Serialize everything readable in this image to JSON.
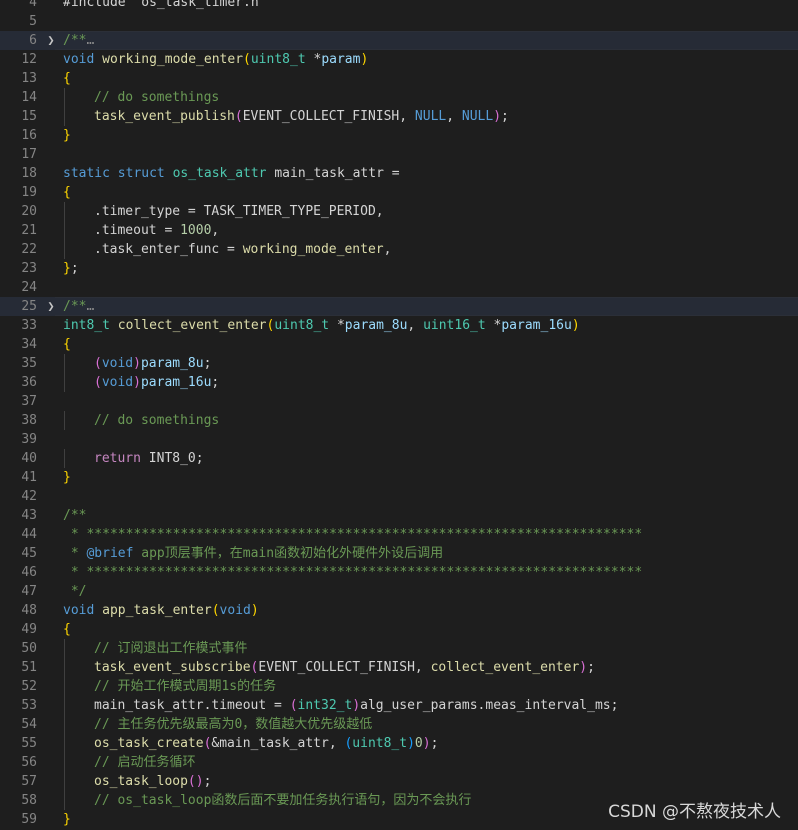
{
  "theme": {
    "background": "#1e1e1e",
    "line_number": "#858585",
    "colors": {
      "keyword": "#569cd6",
      "control": "#c586c0",
      "type": "#4ec9b0",
      "function": "#dcdcaa",
      "variable": "#9cdcfe",
      "param": "#9cdcfe",
      "number": "#b5cea8",
      "comment": "#6a9955",
      "doctag": "#569cd6",
      "constant": "#4fc1ff",
      "brace1": "#ffd700",
      "brace2": "#da70d6",
      "brace3": "#179fff",
      "plain": "#d4d4d4"
    }
  },
  "lines": [
    {
      "n": "4",
      "tokens": [
        [
          "#include \"os_task_timer.h\"",
          "plain"
        ]
      ]
    },
    {
      "n": "5",
      "tokens": []
    },
    {
      "n": "6",
      "fold": true,
      "hl": true,
      "tokens": [
        [
          "/**",
          "comment"
        ],
        [
          "…",
          "ellipsis"
        ]
      ]
    },
    {
      "n": "12",
      "tokens": [
        [
          "void",
          "keyword"
        ],
        [
          " ",
          "plain"
        ],
        [
          "working_mode_enter",
          "function"
        ],
        [
          "(",
          "brace1"
        ],
        [
          "uint8_t",
          "type"
        ],
        [
          " *",
          "plain"
        ],
        [
          "param",
          "param"
        ],
        [
          ")",
          "brace1"
        ]
      ]
    },
    {
      "n": "13",
      "tokens": [
        [
          "{",
          "brace1"
        ]
      ]
    },
    {
      "n": "14",
      "indent": 1,
      "tokens": [
        [
          "// do somethings",
          "comment"
        ]
      ]
    },
    {
      "n": "15",
      "indent": 1,
      "tokens": [
        [
          "task_event_publish",
          "function"
        ],
        [
          "(",
          "brace2"
        ],
        [
          "EVENT_COLLECT_FINISH",
          "plain"
        ],
        [
          ", ",
          "plain"
        ],
        [
          "NULL",
          "keyword"
        ],
        [
          ", ",
          "plain"
        ],
        [
          "NULL",
          "keyword"
        ],
        [
          ")",
          "brace2"
        ],
        [
          ";",
          "plain"
        ]
      ]
    },
    {
      "n": "16",
      "tokens": [
        [
          "}",
          "brace1"
        ]
      ]
    },
    {
      "n": "17",
      "tokens": []
    },
    {
      "n": "18",
      "tokens": [
        [
          "static",
          "keyword"
        ],
        [
          " ",
          "plain"
        ],
        [
          "struct",
          "keyword"
        ],
        [
          " ",
          "plain"
        ],
        [
          "os_task_attr",
          "type"
        ],
        [
          " main_task_attr =",
          "plain"
        ]
      ]
    },
    {
      "n": "19",
      "tokens": [
        [
          "{",
          "brace1"
        ]
      ]
    },
    {
      "n": "20",
      "indent": 1,
      "tokens": [
        [
          ".timer_type",
          "plain"
        ],
        [
          " = ",
          "plain"
        ],
        [
          "TASK_TIMER_TYPE_PERIOD",
          "plain"
        ],
        [
          ",",
          "plain"
        ]
      ]
    },
    {
      "n": "21",
      "indent": 1,
      "tokens": [
        [
          ".timeout",
          "plain"
        ],
        [
          " = ",
          "plain"
        ],
        [
          "1000",
          "number"
        ],
        [
          ",",
          "plain"
        ]
      ]
    },
    {
      "n": "22",
      "indent": 1,
      "tokens": [
        [
          ".task_enter_func",
          "plain"
        ],
        [
          " = ",
          "plain"
        ],
        [
          "working_mode_enter",
          "function"
        ],
        [
          ",",
          "plain"
        ]
      ]
    },
    {
      "n": "23",
      "tokens": [
        [
          "}",
          "brace1"
        ],
        [
          ";",
          "plain"
        ]
      ]
    },
    {
      "n": "24",
      "tokens": []
    },
    {
      "n": "25",
      "fold": true,
      "hl": true,
      "tokens": [
        [
          "/**",
          "comment"
        ],
        [
          "…",
          "ellipsis"
        ]
      ]
    },
    {
      "n": "33",
      "tokens": [
        [
          "int8_t",
          "type"
        ],
        [
          " ",
          "plain"
        ],
        [
          "collect_event_enter",
          "function"
        ],
        [
          "(",
          "brace1"
        ],
        [
          "uint8_t",
          "type"
        ],
        [
          " *",
          "plain"
        ],
        [
          "param_8u",
          "param"
        ],
        [
          ", ",
          "plain"
        ],
        [
          "uint16_t",
          "type"
        ],
        [
          " *",
          "plain"
        ],
        [
          "param_16u",
          "param"
        ],
        [
          ")",
          "brace1"
        ]
      ]
    },
    {
      "n": "34",
      "tokens": [
        [
          "{",
          "brace1"
        ]
      ]
    },
    {
      "n": "35",
      "indent": 1,
      "tokens": [
        [
          "(",
          "brace2"
        ],
        [
          "void",
          "keyword"
        ],
        [
          ")",
          "brace2"
        ],
        [
          "param_8u",
          "param"
        ],
        [
          ";",
          "plain"
        ]
      ]
    },
    {
      "n": "36",
      "indent": 1,
      "tokens": [
        [
          "(",
          "brace2"
        ],
        [
          "void",
          "keyword"
        ],
        [
          ")",
          "brace2"
        ],
        [
          "param_16u",
          "param"
        ],
        [
          ";",
          "plain"
        ]
      ]
    },
    {
      "n": "37",
      "tokens": []
    },
    {
      "n": "38",
      "indent": 1,
      "tokens": [
        [
          "// do somethings",
          "comment"
        ]
      ]
    },
    {
      "n": "39",
      "tokens": []
    },
    {
      "n": "40",
      "indent": 1,
      "tokens": [
        [
          "return",
          "control"
        ],
        [
          " ",
          "plain"
        ],
        [
          "INT8_0",
          "plain"
        ],
        [
          ";",
          "plain"
        ]
      ]
    },
    {
      "n": "41",
      "tokens": [
        [
          "}",
          "brace1"
        ]
      ]
    },
    {
      "n": "42",
      "tokens": []
    },
    {
      "n": "43",
      "tokens": [
        [
          "/**",
          "comment"
        ]
      ]
    },
    {
      "n": "44",
      "tokens": [
        [
          " * ***********************************************************************",
          "comment"
        ]
      ]
    },
    {
      "n": "45",
      "tokens": [
        [
          " * ",
          "comment"
        ],
        [
          "@brief",
          "doctag"
        ],
        [
          " app顶层事件，在main函数初始化外硬件外设后调用",
          "comment"
        ]
      ]
    },
    {
      "n": "46",
      "tokens": [
        [
          " * ***********************************************************************",
          "comment"
        ]
      ]
    },
    {
      "n": "47",
      "tokens": [
        [
          " */",
          "comment"
        ]
      ]
    },
    {
      "n": "48",
      "tokens": [
        [
          "void",
          "keyword"
        ],
        [
          " ",
          "plain"
        ],
        [
          "app_task_enter",
          "function"
        ],
        [
          "(",
          "brace1"
        ],
        [
          "void",
          "keyword"
        ],
        [
          ")",
          "brace1"
        ]
      ]
    },
    {
      "n": "49",
      "tokens": [
        [
          "{",
          "brace1"
        ]
      ]
    },
    {
      "n": "50",
      "indent": 1,
      "tokens": [
        [
          "// 订阅退出工作模式事件",
          "comment"
        ]
      ]
    },
    {
      "n": "51",
      "indent": 1,
      "tokens": [
        [
          "task_event_subscribe",
          "function"
        ],
        [
          "(",
          "brace2"
        ],
        [
          "EVENT_COLLECT_FINISH",
          "plain"
        ],
        [
          ", ",
          "plain"
        ],
        [
          "collect_event_enter",
          "function"
        ],
        [
          ")",
          "brace2"
        ],
        [
          ";",
          "plain"
        ]
      ]
    },
    {
      "n": "52",
      "indent": 1,
      "tokens": [
        [
          "// 开始工作模式周期1s的任务",
          "comment"
        ]
      ]
    },
    {
      "n": "53",
      "indent": 1,
      "tokens": [
        [
          "main_task_attr",
          "plain"
        ],
        [
          ".timeout",
          "plain"
        ],
        [
          " = ",
          "plain"
        ],
        [
          "(",
          "brace2"
        ],
        [
          "int32_t",
          "type"
        ],
        [
          ")",
          "brace2"
        ],
        [
          "alg_user_params",
          "plain"
        ],
        [
          ".meas_interval_ms",
          "plain"
        ],
        [
          ";",
          "plain"
        ]
      ]
    },
    {
      "n": "54",
      "indent": 1,
      "tokens": [
        [
          "// 主任务优先级最高为0，数值越大优先级越低",
          "comment"
        ]
      ]
    },
    {
      "n": "55",
      "indent": 1,
      "tokens": [
        [
          "os_task_create",
          "function"
        ],
        [
          "(",
          "brace2"
        ],
        [
          "&main_task_attr",
          "plain"
        ],
        [
          ", ",
          "plain"
        ],
        [
          "(",
          "brace3"
        ],
        [
          "uint8_t",
          "type"
        ],
        [
          ")",
          "brace3"
        ],
        [
          "0",
          "number"
        ],
        [
          ")",
          "brace2"
        ],
        [
          ";",
          "plain"
        ]
      ]
    },
    {
      "n": "56",
      "indent": 1,
      "tokens": [
        [
          "// 启动任务循环",
          "comment"
        ]
      ]
    },
    {
      "n": "57",
      "indent": 1,
      "tokens": [
        [
          "os_task_loop",
          "function"
        ],
        [
          "(",
          "brace2"
        ],
        [
          ")",
          "brace2"
        ],
        [
          ";",
          "plain"
        ]
      ]
    },
    {
      "n": "58",
      "indent": 1,
      "tokens": [
        [
          "// os_task_loop函数后面不要加任务执行语句，因为不会执行",
          "comment"
        ]
      ]
    },
    {
      "n": "59",
      "tokens": [
        [
          "}",
          "brace1"
        ]
      ]
    }
  ],
  "watermark": "CSDN @不熬夜技术人"
}
